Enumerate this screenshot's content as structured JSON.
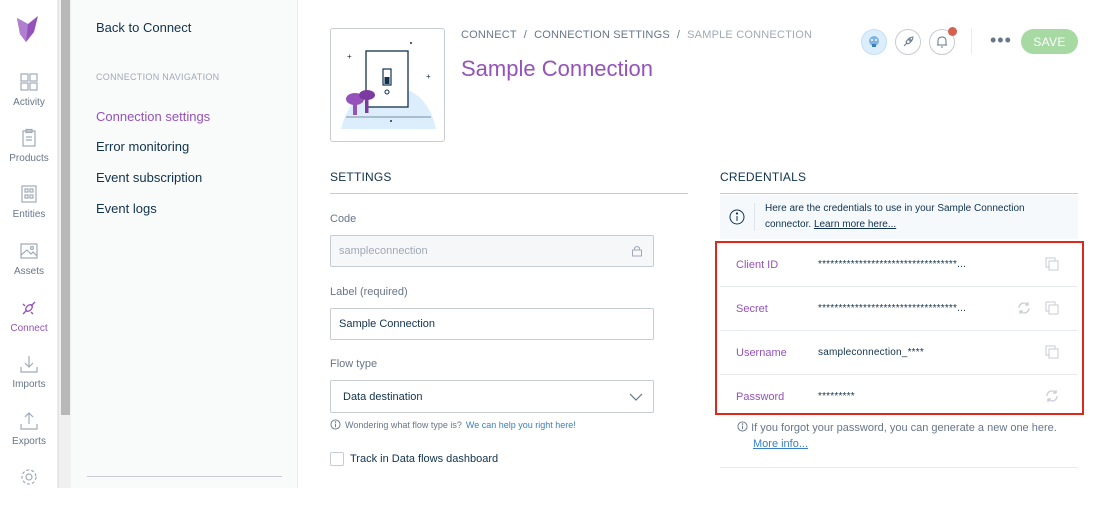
{
  "rail": {
    "items": [
      {
        "label": "Activity",
        "icon": "activity-icon"
      },
      {
        "label": "Products",
        "icon": "products-icon"
      },
      {
        "label": "Entities",
        "icon": "entities-icon"
      },
      {
        "label": "Assets",
        "icon": "assets-icon"
      },
      {
        "label": "Connect",
        "icon": "connect-icon"
      },
      {
        "label": "Imports",
        "icon": "imports-icon"
      },
      {
        "label": "Exports",
        "icon": "exports-icon"
      }
    ],
    "active_label": "Connect",
    "accent": "#9452ba"
  },
  "subnav": {
    "back": "Back to Connect",
    "caption": "CONNECTION NAVIGATION",
    "items": [
      "Connection settings",
      "Error monitoring",
      "Event subscription",
      "Event logs"
    ],
    "active": "Connection settings"
  },
  "header": {
    "breadcrumbs": [
      "CONNECT",
      "CONNECTION SETTINGS",
      "SAMPLE CONNECTION"
    ],
    "separator": "/",
    "title": "Sample Connection",
    "dots": "•••",
    "save": "SAVE",
    "save_color": "#a7d9a3"
  },
  "settings": {
    "section": "SETTINGS",
    "code_label": "Code",
    "code_value": "sampleconnection",
    "label_label": "Label (required)",
    "label_value": "Sample Connection",
    "flow_label": "Flow type",
    "flow_value": "Data destination",
    "hint_text": "Wondering what flow type is?",
    "hint_link": "We can help you right here!",
    "track_label": "Track in Data flows dashboard"
  },
  "credentials": {
    "section": "CREDENTIALS",
    "info_text": "Here are the credentials to use in your Sample Connection connector.",
    "info_link": "Learn more here...",
    "rows": [
      {
        "key": "Client ID",
        "value": "**********************************..."
      },
      {
        "key": "Secret",
        "value": "**********************************..."
      },
      {
        "key": "Username",
        "value": "sampleconnection_****"
      },
      {
        "key": "Password",
        "value": "*********"
      }
    ],
    "forgot_text": "If you forgot your password, you can generate a new one here.",
    "forgot_link": "More info...",
    "highlight_color": "#e1261c"
  }
}
